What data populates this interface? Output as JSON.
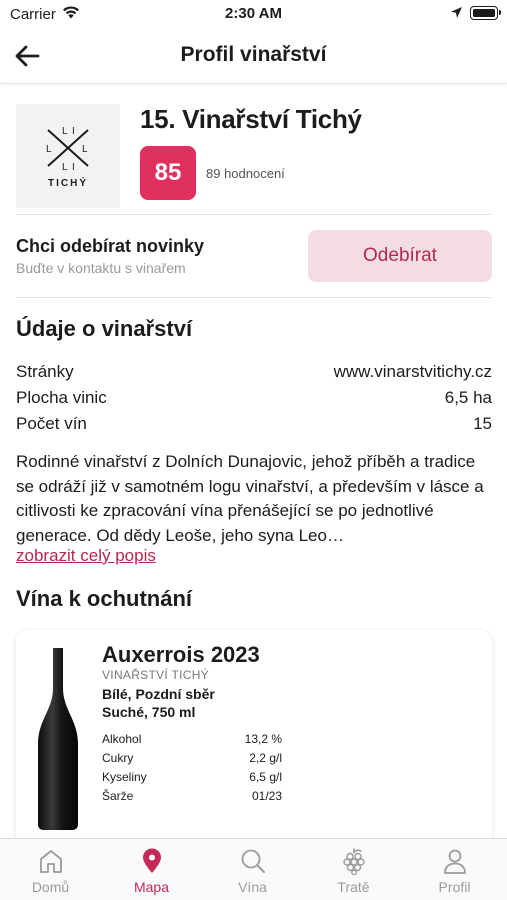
{
  "status_bar": {
    "carrier": "Carrier",
    "time": "2:30 AM"
  },
  "nav": {
    "title": "Profil vinařství"
  },
  "winery": {
    "logo_text": "TICHÝ",
    "name": "15. Vinařství Tichý",
    "score": "85",
    "rating_count": "89 hodnocení"
  },
  "subscribe": {
    "title": "Chci odebírat novinky",
    "subtitle": "Buďte v kontaktu s vinařem",
    "button_label": "Odebírat"
  },
  "info": {
    "title": "Údaje o vinařství",
    "rows": [
      {
        "label": "Stránky",
        "value": "www.vinarstvitichy.cz"
      },
      {
        "label": "Plocha vinic",
        "value": "6,5 ha"
      },
      {
        "label": "Počet vín",
        "value": "15"
      }
    ],
    "description": "Rodinné vinařství z Dolních Dunajovic, jehož příběh a tradice se odráží již v samotném logu vinařství, a především v lásce a citlivosti ke zpracování vína přenášející se po jednotlivé generace. Od dědy Leoše, jeho syna Leo…",
    "more_link": "zobrazit celý popis"
  },
  "wines": {
    "title": "Vína k ochutnání",
    "items": [
      {
        "name": "Auxerrois 2023",
        "producer": "VINAŘSTVÍ TICHÝ",
        "type": "Bílé, Pozdní sběr",
        "sweetness": "Suché, 750 ml",
        "specs": [
          {
            "label": "Alkohol",
            "value": "13,2 %"
          },
          {
            "label": "Cukry",
            "value": "2,2 g/l"
          },
          {
            "label": "Kyseliny",
            "value": "6,5 g/l"
          },
          {
            "label": "Šarže",
            "value": "01/23"
          }
        ]
      }
    ]
  },
  "tabs": [
    {
      "label": "Domů",
      "icon": "home-icon"
    },
    {
      "label": "Mapa",
      "icon": "map-pin-icon",
      "active": true
    },
    {
      "label": "Vína",
      "icon": "search-icon"
    },
    {
      "label": "Tratě",
      "icon": "grapes-icon"
    },
    {
      "label": "Profil",
      "icon": "profile-icon"
    }
  ],
  "colors": {
    "accent": "#c42a55",
    "score_badge": "#e0315e",
    "subscribe_bg": "#f3dde3",
    "muted_text": "#9b9b9b"
  }
}
